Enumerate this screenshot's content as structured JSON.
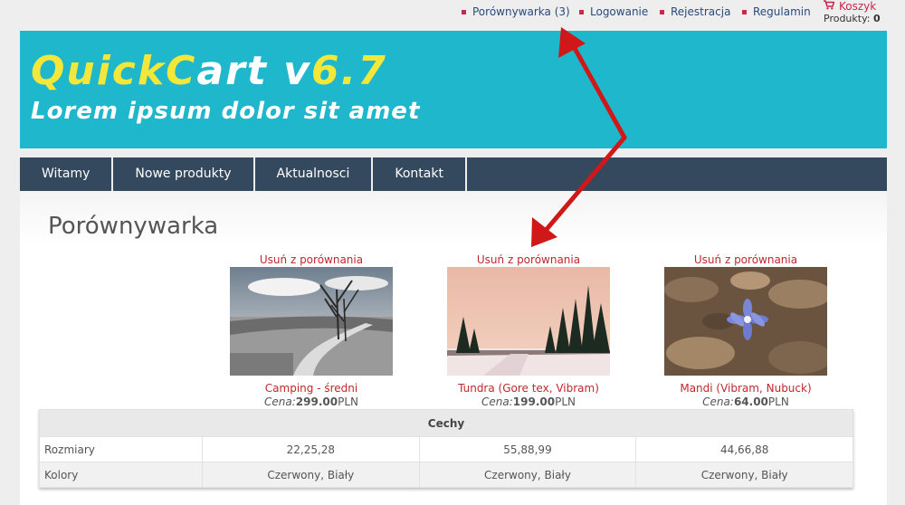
{
  "toplinks": {
    "compare": "Porównywarka (3)",
    "login": "Logowanie",
    "register": "Rejestracja",
    "rules": "Regulamin"
  },
  "cart": {
    "label": "Koszyk",
    "products_label": "Produkty:",
    "products_count": "0"
  },
  "banner": {
    "title_part1": "Quick",
    "title_part2": "C",
    "title_part3": "art v",
    "title_part4": "6.7",
    "subtitle": "Lorem ipsum dolor sit amet"
  },
  "nav": {
    "items": [
      "Witamy",
      "Nowe produkty",
      "Aktualnosci",
      "Kontakt"
    ]
  },
  "page": {
    "title": "Porównywarka"
  },
  "products": [
    {
      "remove_label": "Usuń z porównania",
      "name": "Camping - średni",
      "price_label": "Cena:",
      "price": "299.00",
      "currency": "PLN",
      "image_icon": "landscape-path-trees-image"
    },
    {
      "remove_label": "Usuń z porównania",
      "name": "Tundra (Gore tex, Vibram)",
      "price_label": "Cena:",
      "price": "199.00",
      "currency": "PLN",
      "image_icon": "winter-forest-image"
    },
    {
      "remove_label": "Usuń z porównania",
      "name": "Mandi (Vibram, Nubuck)",
      "price_label": "Cena:",
      "price": "64.00",
      "currency": "PLN",
      "image_icon": "blue-flower-image"
    }
  ],
  "table": {
    "header": "Cechy",
    "rows": [
      {
        "label": "Rozmiary",
        "values": [
          "22,25,28",
          "55,88,99",
          "44,66,88"
        ]
      },
      {
        "label": "Kolory",
        "values": [
          "Czerwony, Biały",
          "Czerwony, Biały",
          "Czerwony, Biały"
        ]
      }
    ]
  },
  "colors": {
    "banner": "#1fb7cc",
    "nav": "#34495e",
    "link_red": "#c0272d",
    "arrow_red": "#d01818",
    "logo_yellow": "#f3e839"
  }
}
